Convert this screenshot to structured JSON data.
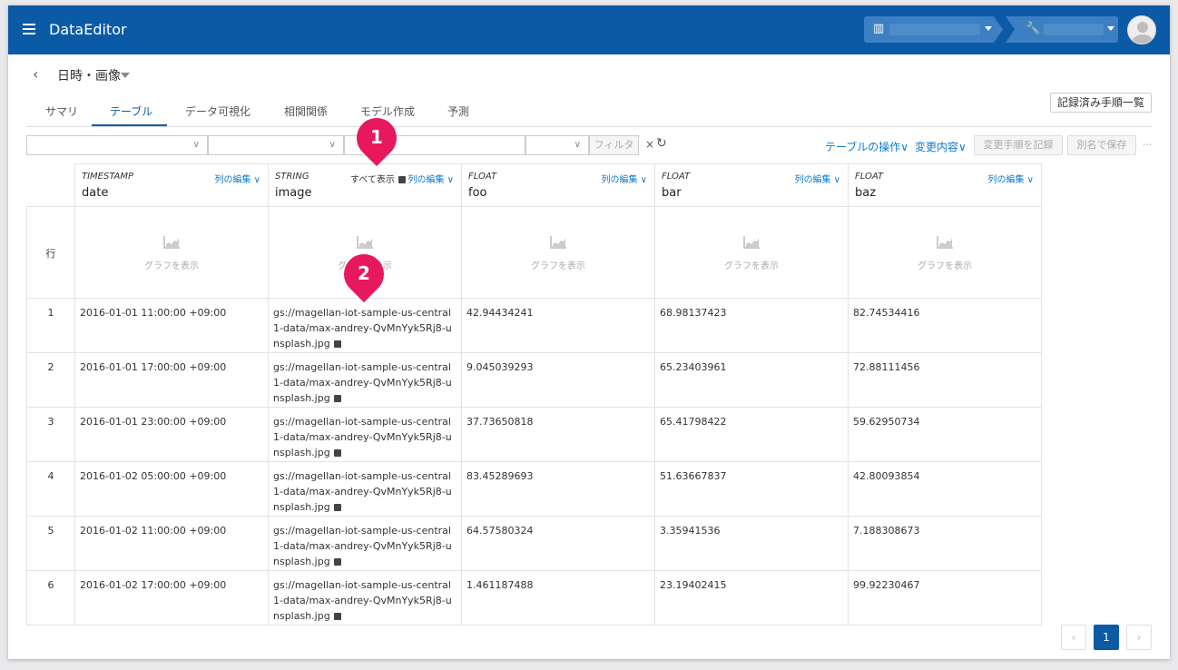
{
  "app": {
    "title": "DataEditor"
  },
  "page": {
    "title": "日時・画像"
  },
  "tabs": [
    {
      "label": "サマリ"
    },
    {
      "label": "テーブル"
    },
    {
      "label": "データ可視化"
    },
    {
      "label": "相関関係"
    },
    {
      "label": "モデル作成"
    },
    {
      "label": "予測"
    }
  ],
  "toolbar": {
    "record_list": "記録済み手順一覧",
    "filter": "フィルタ",
    "clear": "×",
    "table_ops": "テーブルの操作",
    "changes": "変更内容",
    "record_steps": "変更手順を記録",
    "save_as": "別名で保存",
    "more": "···"
  },
  "table": {
    "row_label": "行",
    "edit_label": "列の編集",
    "show_all": "すべて表示",
    "chart_caption": "グラフを表示",
    "columns": [
      {
        "type": "TIMESTAMP",
        "name": "date"
      },
      {
        "type": "STRING",
        "name": "image"
      },
      {
        "type": "FLOAT",
        "name": "foo"
      },
      {
        "type": "FLOAT",
        "name": "bar"
      },
      {
        "type": "FLOAT",
        "name": "baz"
      }
    ],
    "rows": [
      {
        "n": "1",
        "date": "2016-01-01 11:00:00 +09:00",
        "image": "gs://magellan-iot-sample-us-central1-data/max-andrey-QvMnYyk5Rj8-unsplash.jpg",
        "foo": "42.94434241",
        "bar": "68.98137423",
        "baz": "82.74534416"
      },
      {
        "n": "2",
        "date": "2016-01-01 17:00:00 +09:00",
        "image": "gs://magellan-iot-sample-us-central1-data/max-andrey-QvMnYyk5Rj8-unsplash.jpg",
        "foo": "9.045039293",
        "bar": "65.23403961",
        "baz": "72.88111456"
      },
      {
        "n": "3",
        "date": "2016-01-01 23:00:00 +09:00",
        "image": "gs://magellan-iot-sample-us-central1-data/max-andrey-QvMnYyk5Rj8-unsplash.jpg",
        "foo": "37.73650818",
        "bar": "65.41798422",
        "baz": "59.62950734"
      },
      {
        "n": "4",
        "date": "2016-01-02 05:00:00 +09:00",
        "image": "gs://magellan-iot-sample-us-central1-data/max-andrey-QvMnYyk5Rj8-unsplash.jpg",
        "foo": "83.45289693",
        "bar": "51.63667837",
        "baz": "42.80093854"
      },
      {
        "n": "5",
        "date": "2016-01-02 11:00:00 +09:00",
        "image": "gs://magellan-iot-sample-us-central1-data/max-andrey-QvMnYyk5Rj8-unsplash.jpg",
        "foo": "64.57580324",
        "bar": "3.35941536",
        "baz": "7.188308673"
      },
      {
        "n": "6",
        "date": "2016-01-02 17:00:00 +09:00",
        "image": "gs://magellan-iot-sample-us-central1-data/max-andrey-QvMnYyk5Rj8-unsplash.jpg",
        "foo": "1.461187488",
        "bar": "23.19402415",
        "baz": "99.92230467"
      }
    ]
  },
  "callouts": [
    {
      "label": "1"
    },
    {
      "label": "2"
    }
  ],
  "pagination": {
    "prev": "‹",
    "current": "1",
    "next": "›"
  },
  "colors": {
    "header": "#0b5aa6",
    "link": "#0b7bd0",
    "callout": "#e8185d"
  }
}
